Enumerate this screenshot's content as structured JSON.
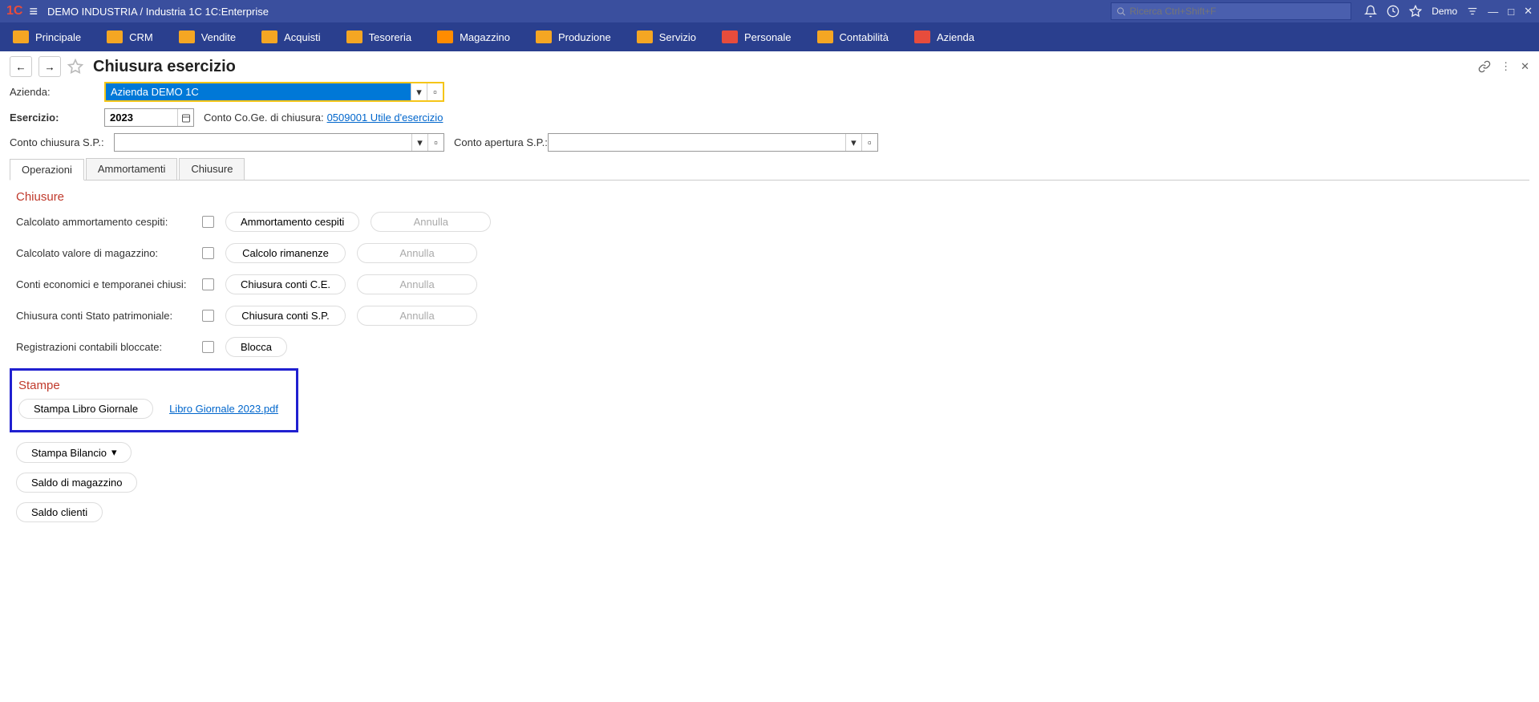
{
  "topbar": {
    "app_title": "DEMO INDUSTRIA / Industria 1C 1C:Enterprise",
    "search_placeholder": "Ricerca Ctrl+Shift+F",
    "demo_label": "Demo"
  },
  "nav": {
    "items": [
      "Principale",
      "CRM",
      "Vendite",
      "Acquisti",
      "Tesoreria",
      "Magazzino",
      "Produzione",
      "Servizio",
      "Personale",
      "Contabilità",
      "Azienda"
    ]
  },
  "page": {
    "title": "Chiusura esercizio"
  },
  "form": {
    "azienda_label": "Azienda:",
    "azienda_value": "Azienda DEMO 1C",
    "esercizio_label": "Esercizio:",
    "esercizio_value": "2023",
    "conto_coge_label": "Conto Co.Ge. di chiusura:",
    "conto_coge_link": "0509001 Utile d'esercizio",
    "conto_chiusura_label": "Conto chiusura S.P.:",
    "conto_chiusura_value": "",
    "conto_apertura_label": "Conto apertura S.P.:",
    "conto_apertura_value": ""
  },
  "tabs": {
    "operazioni": "Operazioni",
    "ammortamenti": "Ammortamenti",
    "chiusure": "Chiusure"
  },
  "closures": {
    "title": "Chiusure",
    "rows": [
      {
        "label": "Calcolato ammortamento cespiti:",
        "action": "Ammortamento cespiti",
        "cancel": "Annulla"
      },
      {
        "label": "Calcolato valore di magazzino:",
        "action": "Calcolo rimanenze",
        "cancel": "Annulla"
      },
      {
        "label": "Conti economici e temporanei chiusi:",
        "action": "Chiusura conti C.E.",
        "cancel": "Annulla"
      },
      {
        "label": "Chiusura conti Stato patrimoniale:",
        "action": "Chiusura conti S.P.",
        "cancel": "Annulla"
      },
      {
        "label": "Registrazioni contabili bloccate:",
        "action": "Blocca",
        "cancel": ""
      }
    ]
  },
  "stampe": {
    "title": "Stampe",
    "libro_giornale_btn": "Stampa Libro Giornale",
    "libro_giornale_link": "Libro Giornale 2023.pdf",
    "bilancio": "Stampa Bilancio",
    "saldo_magazzino": "Saldo di magazzino",
    "saldo_clienti": "Saldo clienti"
  }
}
